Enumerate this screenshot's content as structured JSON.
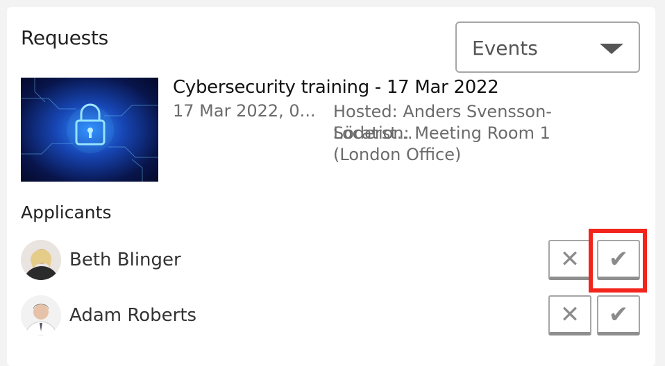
{
  "panel": {
    "title": "Requests"
  },
  "filter": {
    "selected": "Events",
    "caret_icon": "caret-down-icon"
  },
  "event": {
    "image_icon": "cybersecurity-lock-image",
    "title": "Cybersecurity training - 17 Mar 2022",
    "date": "17 Mar 2022, 0...",
    "host": "Hosted: Anders Svensson-Söderst...",
    "location": "Location: Meeting Room 1 (London Office)"
  },
  "applicants": {
    "label": "Applicants",
    "items": [
      {
        "name": "Beth Blinger",
        "reject_symbol": "✕",
        "accept_symbol": "✔"
      },
      {
        "name": "Adam Roberts",
        "reject_symbol": "✕",
        "accept_symbol": "✔"
      }
    ]
  },
  "colors": {
    "highlight": "#f2241b",
    "text": "#222222",
    "muted": "#6b6b6b"
  }
}
